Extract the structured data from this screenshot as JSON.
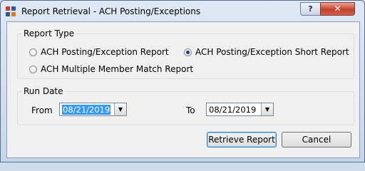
{
  "window": {
    "title": "Report Retrieval - ACH Posting/Exceptions",
    "help_label": "?",
    "close_label": "✕"
  },
  "report_type": {
    "legend": "Report Type",
    "options": [
      {
        "label": "ACH Posting/Exception Report",
        "checked": false
      },
      {
        "label": "ACH Posting/Exception Short Report",
        "checked": true
      },
      {
        "label": "ACH Multiple Member Match Report",
        "checked": false
      }
    ]
  },
  "run_date": {
    "legend": "Run Date",
    "from_label": "From",
    "from_value": "08/21/2019",
    "to_label": "To",
    "to_value": "08/21/2019"
  },
  "buttons": {
    "retrieve": "Retrieve Report",
    "cancel": "Cancel"
  },
  "colors": {
    "selection": "#3399ff",
    "close_button": "#c4412b"
  }
}
